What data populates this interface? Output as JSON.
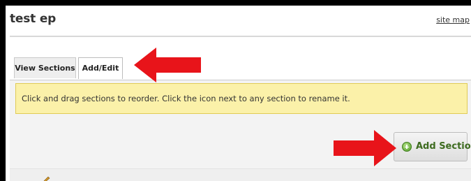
{
  "page": {
    "title": "test ep",
    "site_map_label": "site map"
  },
  "tabs": [
    {
      "label": "View Sections",
      "active": false
    },
    {
      "label": "Add/Edit",
      "active": true
    }
  ],
  "notice": {
    "text": "Click and drag sections to reorder. Click the icon next to any section to rename it."
  },
  "actions": {
    "add_section_label": "Add Section",
    "add_icon": "plus-circle-icon"
  },
  "annotations": {
    "arrow_color": "#e8141a",
    "arrow_icon": "red-arrow"
  },
  "colors": {
    "notice_bg": "#fbf1a9",
    "notice_border": "#e0cb55",
    "button_text": "#3d6b1f"
  }
}
